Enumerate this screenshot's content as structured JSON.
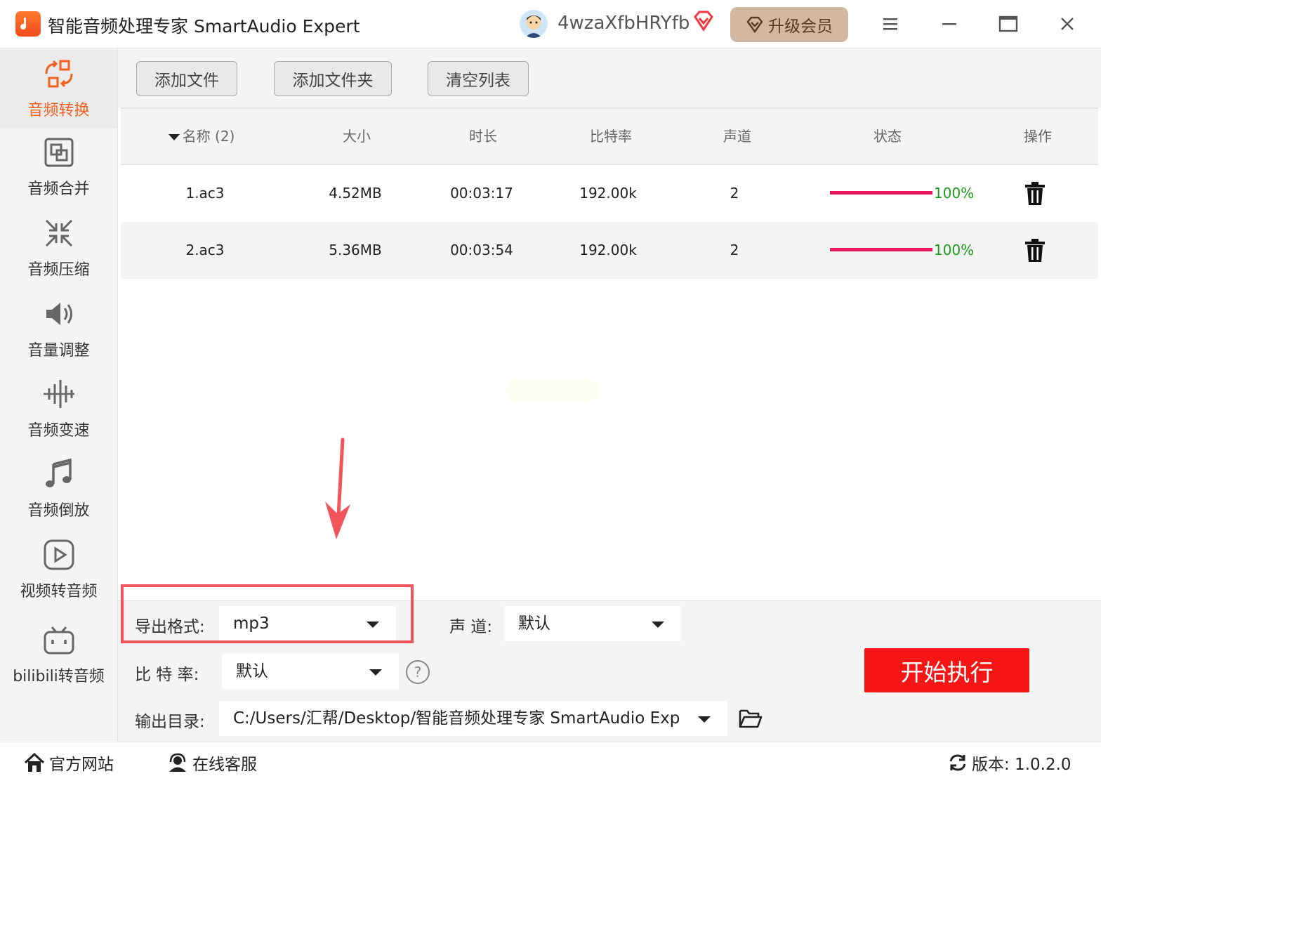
{
  "app": {
    "title": "智能音频处理专家 SmartAudio Expert"
  },
  "user": {
    "name": "4wzaXfbHRYfb",
    "upgrade_label": "升级会员"
  },
  "sidebar": {
    "items": [
      {
        "label": "音频转换",
        "icon": "convert-icon",
        "active": true
      },
      {
        "label": "音频合并",
        "icon": "merge-icon"
      },
      {
        "label": "音频压缩",
        "icon": "compress-icon"
      },
      {
        "label": "音量调整",
        "icon": "volume-icon"
      },
      {
        "label": "音频变速",
        "icon": "speed-icon"
      },
      {
        "label": "音频倒放",
        "icon": "music-note-icon"
      },
      {
        "label": "视频转音频",
        "icon": "play-icon"
      },
      {
        "label": "bilibili转音频",
        "icon": "bilibili-icon"
      }
    ]
  },
  "toolbar": {
    "add_file": "添加文件",
    "add_folder": "添加文件夹",
    "clear_list": "清空列表"
  },
  "table": {
    "columns": {
      "name": "名称 (2)",
      "size": "大小",
      "duration": "时长",
      "bitrate": "比特率",
      "channels": "声道",
      "status": "状态",
      "action": "操作"
    },
    "rows": [
      {
        "name": "1.ac3",
        "size": "4.52MB",
        "duration": "00:03:17",
        "bitrate": "192.00k",
        "channels": "2",
        "progress": 100,
        "progress_text": "100%"
      },
      {
        "name": "2.ac3",
        "size": "5.36MB",
        "duration": "00:03:54",
        "bitrate": "192.00k",
        "channels": "2",
        "progress": 100,
        "progress_text": "100%"
      }
    ]
  },
  "settings": {
    "format_label": "导出格式:",
    "format_value": "mp3",
    "channel_label": "声 道:",
    "channel_value": "默认",
    "bitrate_label": "比 特 率:",
    "bitrate_value": "默认",
    "output_label": "输出目录:",
    "output_value": "C:/Users/汇帮/Desktop/智能音频处理专家 SmartAudio Exp",
    "help_text": "?"
  },
  "start_button": "开始执行",
  "statusbar": {
    "website": "官方网站",
    "support": "在线客服",
    "version": "版本: 1.0.2.0"
  },
  "colors": {
    "accent": "#f25f1f",
    "start": "#f61616",
    "progress": "#e8175d",
    "progress_text": "#1a9c1a",
    "highlight": "#f2545b",
    "upgrade_bg": "#d2b8a0"
  }
}
